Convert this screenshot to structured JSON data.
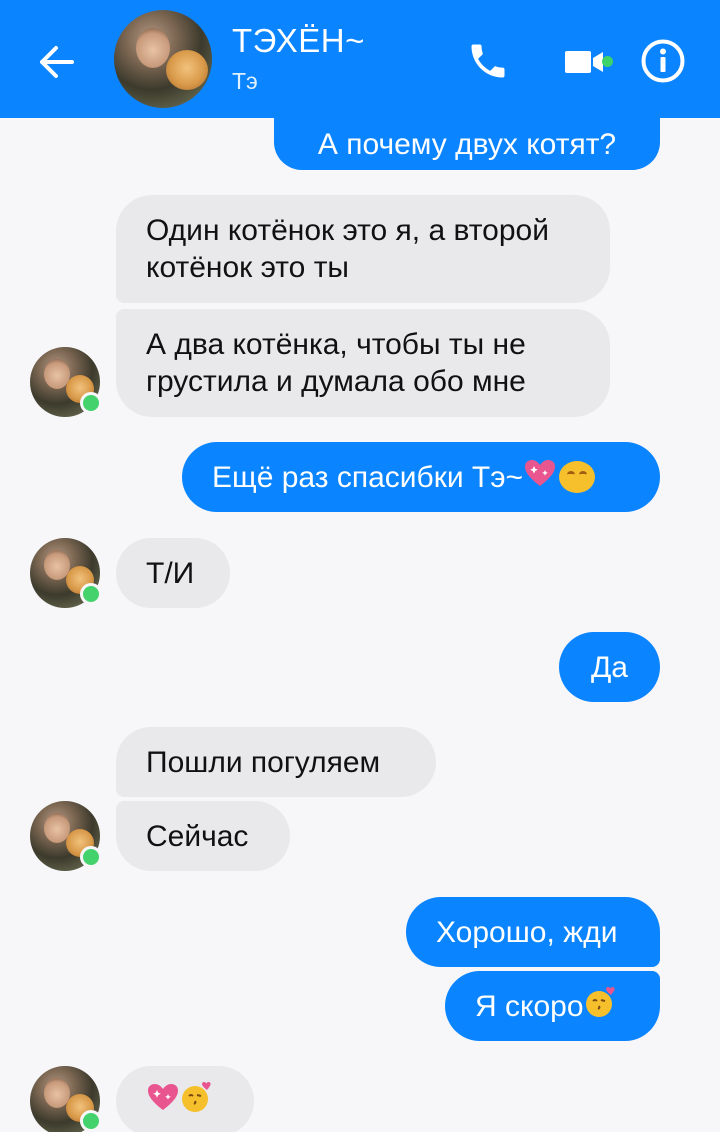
{
  "header": {
    "contact_name": "ТЭХЁН~",
    "contact_subtitle": "Тэ",
    "colors": {
      "bar": "#0a84ff",
      "online": "#3ed26b"
    }
  },
  "messages": [
    {
      "side": "out",
      "text": "А почему двух котят?"
    },
    {
      "side": "in",
      "text_line1": "Один котёнок это я, а второй",
      "text_line2": "котёнок это ты"
    },
    {
      "side": "in",
      "text_line1": "А два котёнка, чтобы ты не",
      "text_line2": "грустила и думала обо мне"
    },
    {
      "side": "out",
      "text": "Ещё раз спасибки Тэ~",
      "emoji": [
        "sparkling-heart",
        "smiling-face"
      ]
    },
    {
      "side": "in",
      "text": "Т/И"
    },
    {
      "side": "out",
      "text": "Да"
    },
    {
      "side": "in",
      "text": "Пошли погуляем"
    },
    {
      "side": "in",
      "text": "Сейчас"
    },
    {
      "side": "out",
      "text": "Хорошо, жди"
    },
    {
      "side": "out",
      "text": "Я скоро",
      "emoji": [
        "kissing-face"
      ]
    },
    {
      "side": "in",
      "text": "",
      "emoji": [
        "sparkling-heart",
        "kissing-face"
      ]
    }
  ],
  "colors": {
    "outgoing": "#0a84ff",
    "incoming": "#e9e9ec",
    "background": "#f7f7f9"
  }
}
